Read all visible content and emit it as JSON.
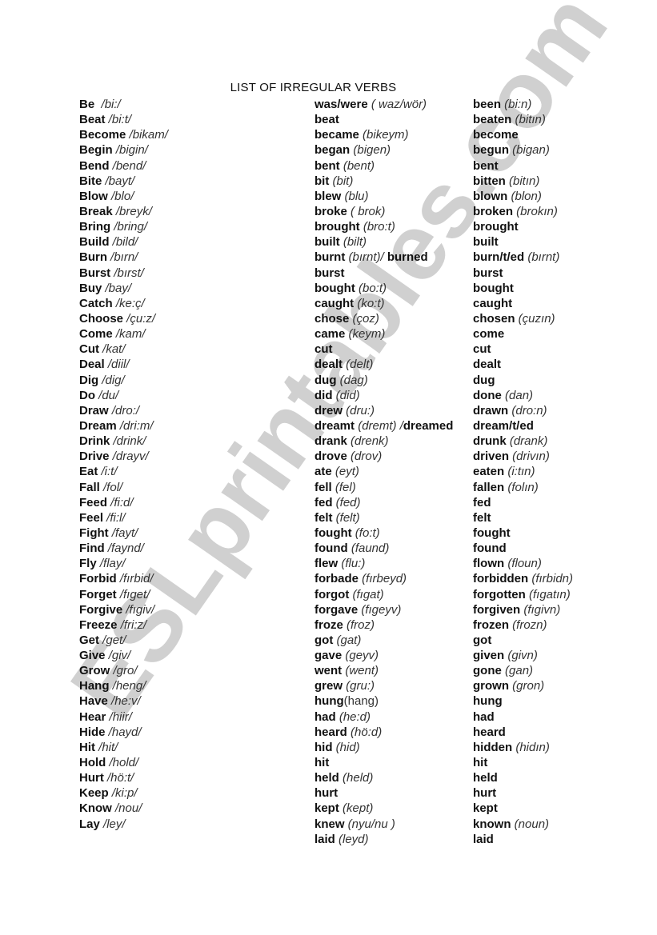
{
  "title": "LIST OF IRREGULAR VERBS",
  "watermark": "ESLprintables.com",
  "columns": {
    "base": [
      {
        "word": "Be",
        "pron": "  /bi:/"
      },
      {
        "word": "Beat",
        "pron": " /bi:t/"
      },
      {
        "word": "Become",
        "pron": " /bikam/"
      },
      {
        "word": "Begin",
        "pron": " /bigin/"
      },
      {
        "word": "Bend",
        "pron": " /bend/"
      },
      {
        "word": "Bite",
        "pron": " /bayt/"
      },
      {
        "word": "Blow",
        "pron": " /blo/"
      },
      {
        "word": "Break",
        "pron": " /breyk/"
      },
      {
        "word": "Bring",
        "pron": " /bring/"
      },
      {
        "word": "Build",
        "pron": " /bild/"
      },
      {
        "word": "Burn",
        "pron": " /bırn/"
      },
      {
        "word": "Burst",
        "pron": " /bırst/"
      },
      {
        "word": "Buy",
        "pron": " /bay/"
      },
      {
        "word": "Catch",
        "pron": " /ke:ç/"
      },
      {
        "word": "Choose",
        "pron": " /çu:z/"
      },
      {
        "word": "Come",
        "pron": " /kam/"
      },
      {
        "word": "Cut",
        "pron": " /kat/"
      },
      {
        "word": "Deal",
        "pron": " /diil/"
      },
      {
        "word": "Dig",
        "pron": " /dig/"
      },
      {
        "word": "Do",
        "pron": " /du/"
      },
      {
        "word": "Draw",
        "pron": " /dro:/"
      },
      {
        "word": "Dream",
        "pron": " /dri:m/"
      },
      {
        "word": "Drink",
        "pron": " /drink/"
      },
      {
        "word": "Drive",
        "pron": " /drayv/"
      },
      {
        "word": "Eat",
        "pron": " /i:t/"
      },
      {
        "word": "Fall",
        "pron": " /fol/"
      },
      {
        "word": "Feed",
        "pron": " /fi:d/"
      },
      {
        "word": "Feel",
        "pron": " /fi:l/"
      },
      {
        "word": "Fight",
        "pron": " /fayt/"
      },
      {
        "word": "Find",
        "pron": " /faynd/"
      },
      {
        "word": "Fly",
        "pron": " /flay/"
      },
      {
        "word": "Forbid",
        "pron": " /fırbid/"
      },
      {
        "word": "Forget",
        "pron": " /fıget/"
      },
      {
        "word": "Forgive",
        "pron": " /fıgiv/"
      },
      {
        "word": "Freeze",
        "pron": " /fri:z/"
      },
      {
        "word": "Get",
        "pron": " /get/"
      },
      {
        "word": "Give",
        "pron": " /giv/"
      },
      {
        "word": "Grow",
        "pron": " /gro/"
      },
      {
        "word": "Hang",
        "pron": " /heng/"
      },
      {
        "word": "Have",
        "pron": " /he:v/"
      },
      {
        "word": "Hear",
        "pron": " /hiir/"
      },
      {
        "word": "Hide",
        "pron": " /hayd/"
      },
      {
        "word": "Hit",
        "pron": " /hit/"
      },
      {
        "word": "Hold",
        "pron": " /hold/"
      },
      {
        "word": "Hurt",
        "pron": " /hö:t/"
      },
      {
        "word": "Keep",
        "pron": " /ki:p/"
      },
      {
        "word": "Know",
        "pron": " /nou/"
      },
      {
        "word": "Lay",
        "pron": " /ley/"
      }
    ],
    "past": [
      {
        "word": "was/were",
        "pron": " ( waz/wör)"
      },
      {
        "word": "beat",
        "pron": ""
      },
      {
        "word": "became",
        "pron": " (bikeym)"
      },
      {
        "word": "began",
        "pron": " (bigen)"
      },
      {
        "word": "bent",
        "pron": " (bent)"
      },
      {
        "word": "bit",
        "pron": " (bit)"
      },
      {
        "word": "blew",
        "pron": " (blu)"
      },
      {
        "word": "broke",
        "pron": " ( brok)"
      },
      {
        "word": "brought",
        "pron": " (bro:t)"
      },
      {
        "word": "built",
        "pron": " (bilt)"
      },
      {
        "word": "burnt",
        "pron": " (bırnt)/",
        "extra": " burned"
      },
      {
        "word": "burst",
        "pron": ""
      },
      {
        "word": "bought",
        "pron": " (bo:t)"
      },
      {
        "word": "caught",
        "pron": " (ko:t)"
      },
      {
        "word": "chose",
        "pron": " (çoz)"
      },
      {
        "word": "came",
        "pron": " (keym)"
      },
      {
        "word": "cut",
        "pron": ""
      },
      {
        "word": "dealt",
        "pron": " (delt)"
      },
      {
        "word": "dug",
        "pron": " (dag)"
      },
      {
        "word": "did",
        "pron": " (did)"
      },
      {
        "word": "drew",
        "pron": " (dru:)"
      },
      {
        "word": "dreamt",
        "pron": " (dremt) /",
        "extra": "dreamed"
      },
      {
        "word": "drank",
        "pron": " (drenk)"
      },
      {
        "word": "drove",
        "pron": " (drov)"
      },
      {
        "word": "ate",
        "pron": " (eyt)"
      },
      {
        "word": "fell",
        "pron": " (fel)"
      },
      {
        "word": "fed",
        "pron": " (fed)"
      },
      {
        "word": "felt",
        "pron": " (felt)"
      },
      {
        "word": "fought",
        "pron": " (fo:t)"
      },
      {
        "word": "found",
        "pron": " (faund)"
      },
      {
        "word": "flew",
        "pron": " (flu:)"
      },
      {
        "word": "forbade",
        "pron": " (fırbeyd)"
      },
      {
        "word": "forgot",
        "pron": " (fıgat)"
      },
      {
        "word": "forgave",
        "pron": " (fıgeyv)"
      },
      {
        "word": "froze",
        "pron": " (froz)"
      },
      {
        "word": "got",
        "pron": " (gat)"
      },
      {
        "word": "gave",
        "pron": " (geyv)"
      },
      {
        "word": "went",
        "pron": " (went)"
      },
      {
        "word": "grew",
        "pron": " (gru:)"
      },
      {
        "word": "hung",
        "pron": "(hang)",
        "plain": true
      },
      {
        "word": "had",
        "pron": " (he:d)"
      },
      {
        "word": "heard",
        "pron": " (hö:d)"
      },
      {
        "word": "hid",
        "pron": " (hid)"
      },
      {
        "word": "hit",
        "pron": ""
      },
      {
        "word": "held",
        "pron": " (held)"
      },
      {
        "word": "hurt",
        "pron": ""
      },
      {
        "word": "kept",
        "pron": " (kept)"
      },
      {
        "word": "knew",
        "pron": " (nyu/nu )"
      },
      {
        "word": "laid",
        "pron": " (leyd)"
      }
    ],
    "past_participle": [
      {
        "word": "been",
        "pron": " (bi:n)"
      },
      {
        "word": "beaten",
        "pron": " (bitın)"
      },
      {
        "word": "become",
        "pron": ""
      },
      {
        "word": "begun",
        "pron": " (bigan)"
      },
      {
        "word": "bent",
        "pron": ""
      },
      {
        "word": "bitten",
        "pron": " (bitın)"
      },
      {
        "word": "blown",
        "pron": " (blon)"
      },
      {
        "word": "broken",
        "pron": " (brokın)"
      },
      {
        "word": "brought",
        "pron": ""
      },
      {
        "word": "built",
        "pron": ""
      },
      {
        "word": "burn/t/ed",
        "pron": " (bırnt)"
      },
      {
        "word": "burst",
        "pron": ""
      },
      {
        "word": "bought",
        "pron": ""
      },
      {
        "word": "caught",
        "pron": ""
      },
      {
        "word": "chosen",
        "pron": " (çuzın)"
      },
      {
        "word": "come",
        "pron": ""
      },
      {
        "word": "cut",
        "pron": ""
      },
      {
        "word": "dealt",
        "pron": ""
      },
      {
        "word": "dug",
        "pron": ""
      },
      {
        "word": "done",
        "pron": " (dan)"
      },
      {
        "word": "drawn",
        "pron": " (dro:n)"
      },
      {
        "word": "dream/t/ed",
        "pron": ""
      },
      {
        "word": "drunk",
        "pron": " (drank)"
      },
      {
        "word": "driven",
        "pron": " (drivın)"
      },
      {
        "word": "eaten",
        "pron": " (i:tın)"
      },
      {
        "word": "fallen",
        "pron": " (folın)"
      },
      {
        "word": "fed",
        "pron": ""
      },
      {
        "word": "felt",
        "pron": ""
      },
      {
        "word": "fought",
        "pron": ""
      },
      {
        "word": "found",
        "pron": ""
      },
      {
        "word": "flown",
        "pron": " (floun)"
      },
      {
        "word": "forbidden",
        "pron": " (fırbidn)"
      },
      {
        "word": "forgotten",
        "pron": " (fıgatın)"
      },
      {
        "word": "forgiven",
        "pron": " (fıgivn)"
      },
      {
        "word": "frozen",
        "pron": " (frozn)"
      },
      {
        "word": "got",
        "pron": ""
      },
      {
        "word": "given",
        "pron": " (givn)"
      },
      {
        "word": "gone",
        "pron": " (gan)"
      },
      {
        "word": "grown",
        "pron": " (gron)"
      },
      {
        "word": "hung",
        "pron": ""
      },
      {
        "word": "had",
        "pron": ""
      },
      {
        "word": "heard",
        "pron": ""
      },
      {
        "word": "hidden",
        "pron": " (hidın)"
      },
      {
        "word": "hit",
        "pron": ""
      },
      {
        "word": "held",
        "pron": ""
      },
      {
        "word": "hurt",
        "pron": ""
      },
      {
        "word": "kept",
        "pron": ""
      },
      {
        "word": "known",
        "pron": " (noun)"
      },
      {
        "word": "laid",
        "pron": ""
      }
    ]
  }
}
